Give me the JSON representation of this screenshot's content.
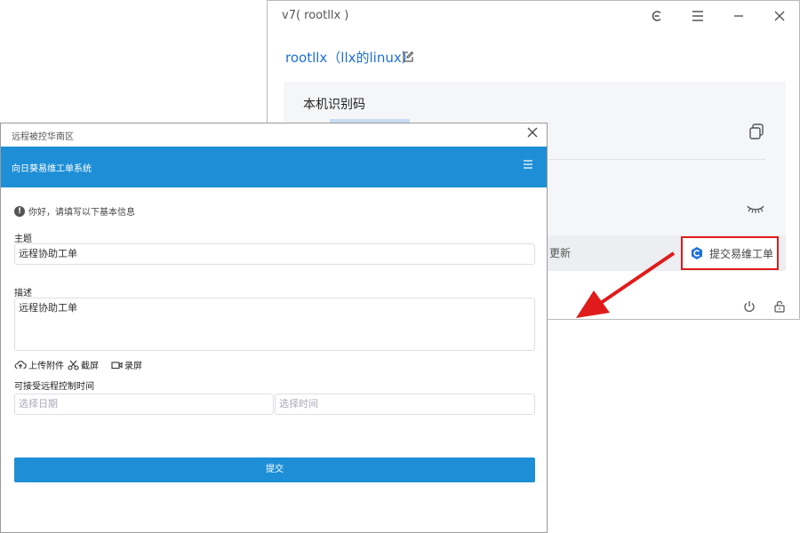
{
  "back_window": {
    "title": "v7( rootllx )",
    "host_name": "rootllx（llx的linux）",
    "id_label": "本机识别码",
    "update_label": "更新",
    "submit_ticket_label": "提交易维工单",
    "icons": [
      "e-icon",
      "hamburger-menu-icon",
      "minimize-icon",
      "close-icon",
      "edit-icon",
      "copy-icon",
      "eye-closed-icon",
      "power-icon",
      "lock-icon"
    ]
  },
  "front_window": {
    "title": "远程被控华南区",
    "header_title": "向日葵易维工单系统",
    "notice": "你好，请填写以下基本信息",
    "subject_label": "主题",
    "subject_value": "远程协助工单",
    "description_label": "描述",
    "description_value": "远程协助工单",
    "tools": {
      "upload": "上传附件",
      "screenshot": "截屏",
      "record": "录屏"
    },
    "time_label": "可接受远程控制时间",
    "date_placeholder": "选择日期",
    "time_placeholder": "选择时间",
    "submit_label": "提交"
  },
  "colors": {
    "brand_blue": "#1e8fd6",
    "link_blue": "#1e6fd9",
    "highlight_red": "#e01b1b"
  }
}
